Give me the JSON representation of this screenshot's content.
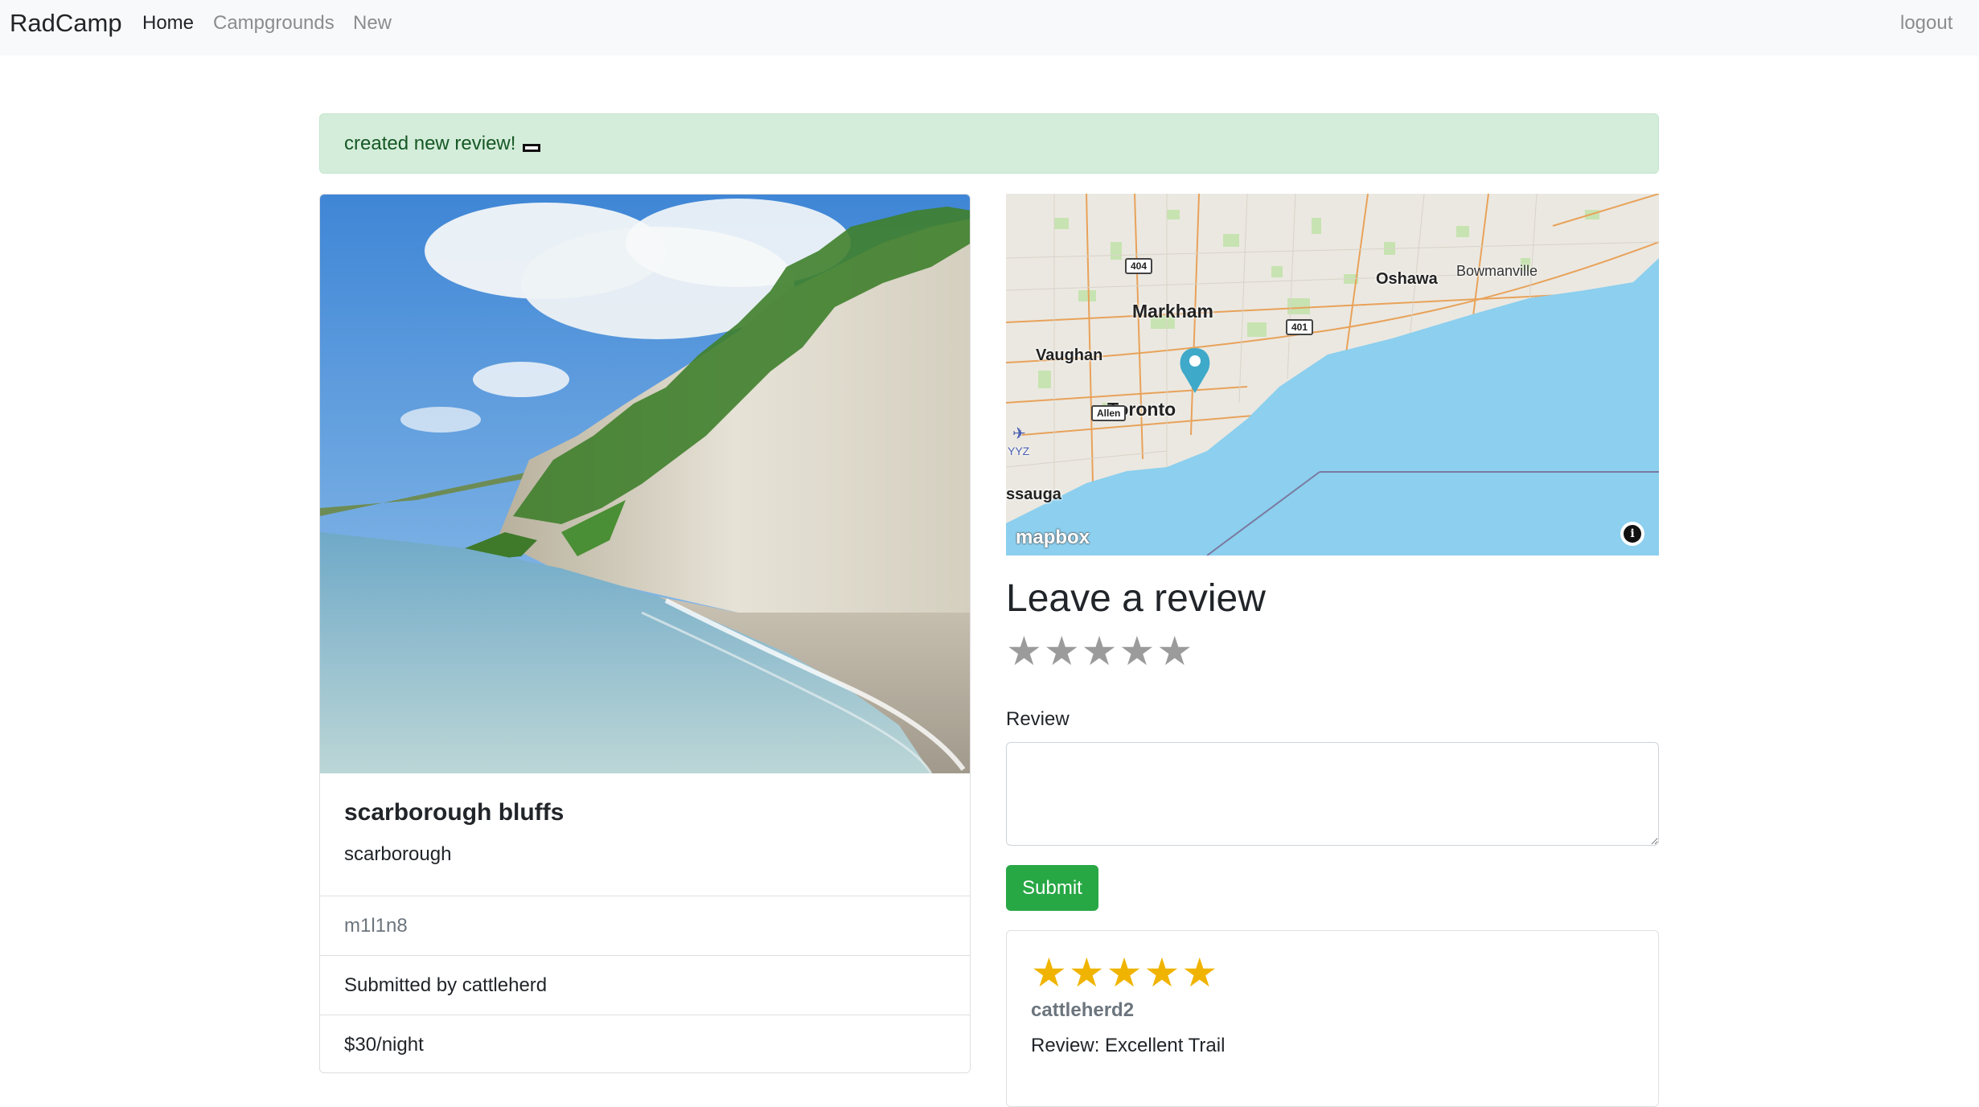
{
  "navbar": {
    "brand": "RadCamp",
    "links": [
      {
        "label": "Home"
      },
      {
        "label": "Campgrounds"
      },
      {
        "label": "New"
      }
    ],
    "logout": "logout"
  },
  "alert": {
    "message": "created new review!"
  },
  "campground": {
    "title": "scarborough bluffs",
    "location": "scarborough",
    "description": "m1l1n8",
    "submitted_by": "Submitted by cattleherd",
    "price": "$30/night"
  },
  "map": {
    "labels": {
      "markham": "Markham",
      "vaughan": "Vaughan",
      "toronto": "Toronto",
      "mississauga": "ssauga",
      "oshawa": "Oshawa",
      "bowmanville": "Bowmanville",
      "yyz": "YYZ"
    },
    "highways": {
      "h404": "404",
      "h401": "401",
      "allen": "Allen"
    },
    "attribution": "mapbox",
    "info_symbol": "i"
  },
  "review_form": {
    "heading": "Leave a review",
    "rating_selected": 0,
    "rating_max": 5,
    "label": "Review",
    "textarea_value": "",
    "submit_label": "Submit"
  },
  "reviews": [
    {
      "rating": 5,
      "author": "cattleherd2",
      "text": "Review: Excellent Trail"
    }
  ],
  "colors": {
    "alert_bg": "#d4edda",
    "alert_text": "#155724",
    "submit_bg": "#28a745",
    "star_filled": "#f0b400",
    "star_empty": "#9b9b9b",
    "map_water": "#8ccfee"
  }
}
